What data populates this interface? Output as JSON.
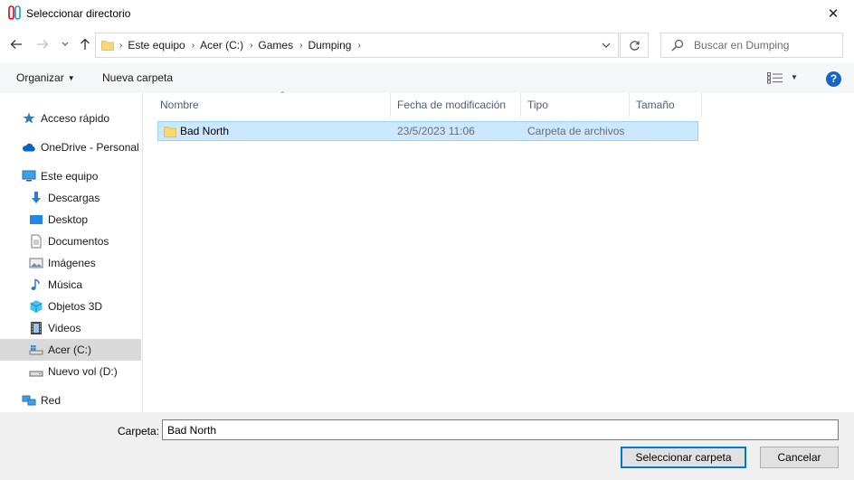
{
  "window": {
    "title": "Seleccionar directorio"
  },
  "address_bar": {
    "crumbs": [
      "Este equipo",
      "Acer (C:)",
      "Games",
      "Dumping"
    ]
  },
  "search": {
    "placeholder": "Buscar en Dumping"
  },
  "toolbar": {
    "organize_label": "Organizar",
    "new_folder_label": "Nueva carpeta"
  },
  "sidebar": {
    "items": [
      {
        "label": "Acceso rápido",
        "icon": "star-icon"
      },
      {
        "label": "OneDrive - Personal",
        "icon": "cloud-icon"
      },
      {
        "label": "Este equipo",
        "icon": "computer-icon"
      },
      {
        "label": "Descargas",
        "icon": "download-icon"
      },
      {
        "label": "Desktop",
        "icon": "desktop-icon"
      },
      {
        "label": "Documentos",
        "icon": "document-icon"
      },
      {
        "label": "Imágenes",
        "icon": "image-icon"
      },
      {
        "label": "Música",
        "icon": "music-icon"
      },
      {
        "label": "Objetos 3D",
        "icon": "cube-icon"
      },
      {
        "label": "Videos",
        "icon": "film-icon"
      },
      {
        "label": "Acer (C:)",
        "icon": "drive-icon",
        "selected": true
      },
      {
        "label": "Nuevo vol (D:)",
        "icon": "drive-icon"
      },
      {
        "label": "Red",
        "icon": "network-icon"
      }
    ]
  },
  "file_list": {
    "columns": [
      "Nombre",
      "Fecha de modificación",
      "Tipo",
      "Tamaño"
    ],
    "rows": [
      {
        "name": "Bad North",
        "modified": "23/5/2023 11:06",
        "type": "Carpeta de archivos",
        "size": ""
      }
    ]
  },
  "footer": {
    "folder_label": "Carpeta:",
    "folder_value": "Bad North",
    "select_button": "Seleccionar carpeta",
    "cancel_button": "Cancelar"
  },
  "colors": {
    "accent": "#0078d7",
    "selection": "#cce8ff",
    "folder": "#f8d775"
  }
}
